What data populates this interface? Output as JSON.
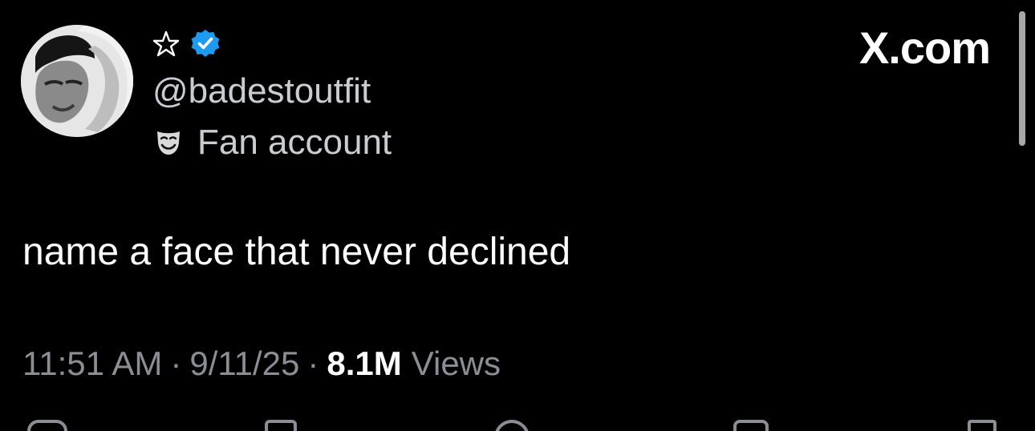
{
  "post": {
    "display_name": "☆",
    "handle": "@badestoutfit",
    "account_label": "Fan account",
    "text": "name a face that never declined",
    "time": "11:51 AM",
    "date": "9/11/25",
    "separator": "·",
    "views_count": "8.1M",
    "views_label": "Views"
  },
  "brand": {
    "watermark": "X.com"
  },
  "icons": {
    "verified": "verified-badge-icon",
    "label": "performing-arts-mask-icon",
    "actions": [
      "reply-icon",
      "repost-icon",
      "like-icon",
      "bookmark-icon",
      "share-icon"
    ]
  },
  "colors": {
    "background": "#000000",
    "text_primary": "#ffffff",
    "text_secondary": "#8b8f95",
    "verified_blue": "#1d9bf0"
  }
}
